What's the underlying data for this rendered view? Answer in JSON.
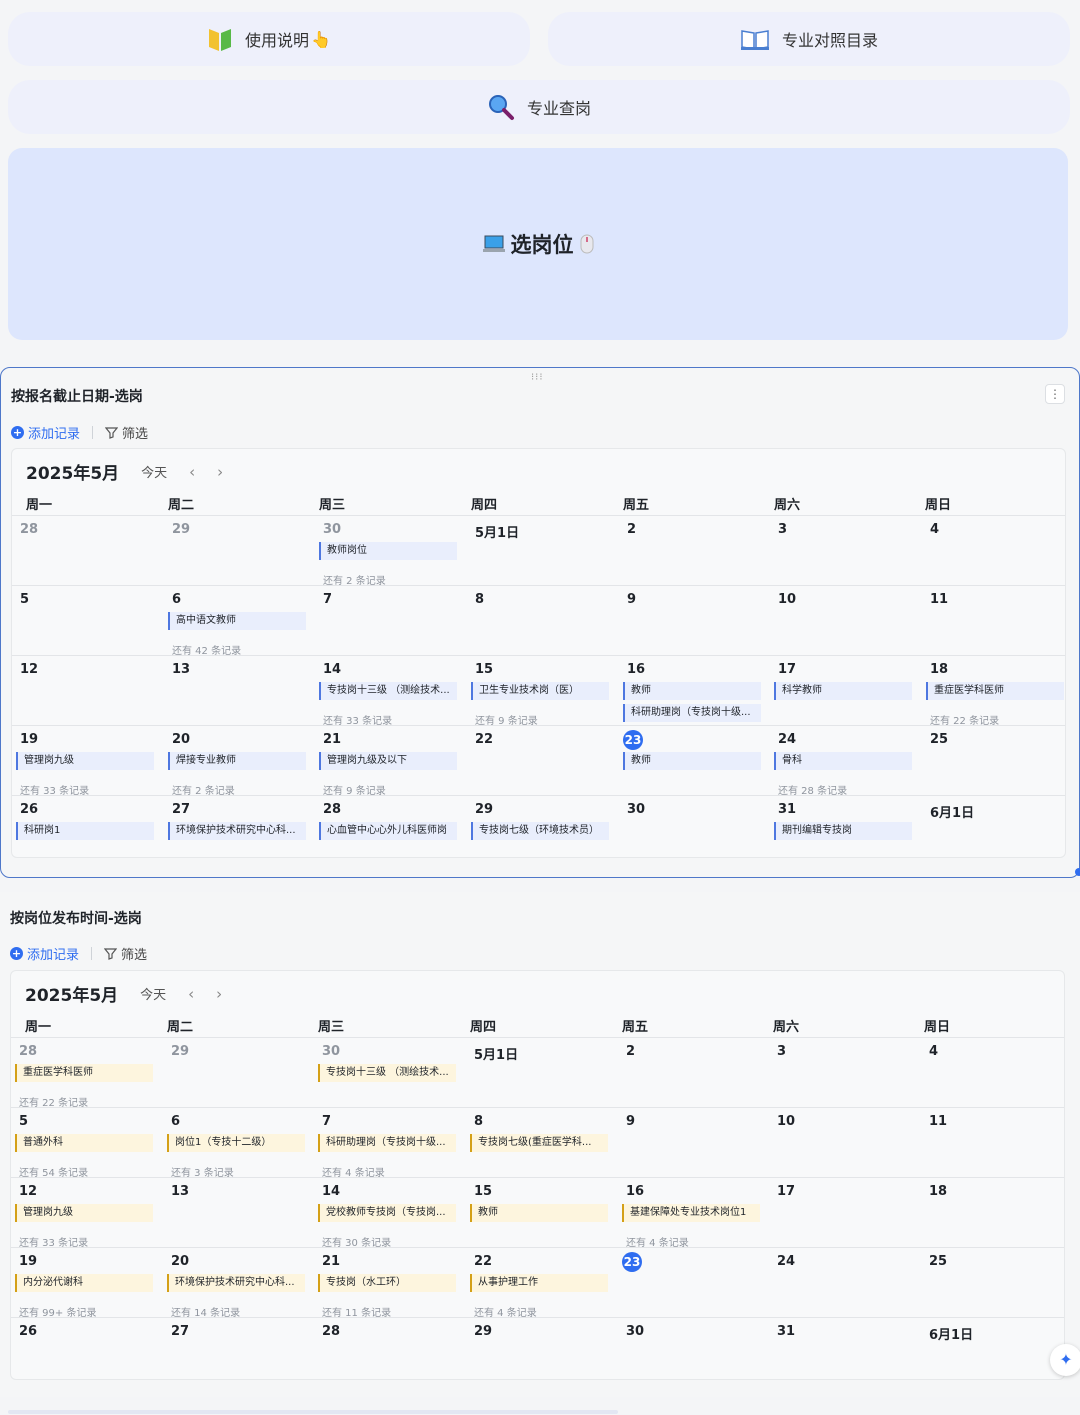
{
  "top_buttons": {
    "usage": {
      "label": "使用说明",
      "icon": "book-green-icon",
      "suffix": "👆"
    },
    "catalog": {
      "label": "专业对照目录",
      "icon": "open-book-icon"
    },
    "search": {
      "label": "专业查岗",
      "icon": "magnifier-icon"
    }
  },
  "hero": {
    "label": "选岗位",
    "icon": "laptop-icon",
    "suffix_icon": "mouse-icon"
  },
  "toolbar": {
    "add_label": "添加记录",
    "filter_label": "筛选"
  },
  "weekdays": [
    "周一",
    "周二",
    "周三",
    "周四",
    "周五",
    "周六",
    "周日"
  ],
  "calendars": [
    {
      "title": "按报名截止日期-选岗",
      "month": "2025年5月",
      "today_label": "今天",
      "weeks": [
        [
          {
            "d": "28",
            "dim": true
          },
          {
            "d": "29",
            "dim": true
          },
          {
            "d": "30",
            "dim": true,
            "ev": [
              "教师岗位"
            ],
            "more": "还有 2 条记录"
          },
          {
            "d": "5月1日"
          },
          {
            "d": "2"
          },
          {
            "d": "3"
          },
          {
            "d": "4"
          }
        ],
        [
          {
            "d": "5"
          },
          {
            "d": "6",
            "ev": [
              "高中语文教师"
            ],
            "more": "还有 42 条记录"
          },
          {
            "d": "7"
          },
          {
            "d": "8"
          },
          {
            "d": "9"
          },
          {
            "d": "10"
          },
          {
            "d": "11"
          }
        ],
        [
          {
            "d": "12"
          },
          {
            "d": "13"
          },
          {
            "d": "14",
            "ev": [
              "专技岗十三级 （测绘技术..."
            ],
            "more": "还有 33 条记录"
          },
          {
            "d": "15",
            "ev": [
              "卫生专业技术岗（医）"
            ],
            "more": "还有 9 条记录"
          },
          {
            "d": "16",
            "ev": [
              "教师",
              "科研助理岗（专技岗十级..."
            ]
          },
          {
            "d": "17",
            "ev": [
              "科学教师"
            ]
          },
          {
            "d": "18",
            "ev": [
              "重症医学科医师"
            ],
            "more": "还有 22 条记录"
          }
        ],
        [
          {
            "d": "19",
            "ev": [
              "管理岗九级"
            ],
            "more": "还有 33 条记录"
          },
          {
            "d": "20",
            "ev": [
              "焊接专业教师"
            ],
            "more": "还有 2 条记录"
          },
          {
            "d": "21",
            "ev": [
              "管理岗九级及以下"
            ],
            "more": "还有 9 条记录"
          },
          {
            "d": "22"
          },
          {
            "d": "23",
            "today": true,
            "ev": [
              "教师"
            ]
          },
          {
            "d": "24",
            "ev": [
              "骨科"
            ],
            "more": "还有 28 条记录"
          },
          {
            "d": "25"
          }
        ],
        [
          {
            "d": "26",
            "ev": [
              "科研岗1"
            ]
          },
          {
            "d": "27",
            "ev": [
              "环境保护技术研究中心科..."
            ]
          },
          {
            "d": "28",
            "ev": [
              "心血管中心心外儿科医师岗"
            ]
          },
          {
            "d": "29",
            "ev": [
              "专技岗七级（环境技术员）"
            ]
          },
          {
            "d": "30"
          },
          {
            "d": "31",
            "ev": [
              "期刊编辑专技岗"
            ]
          },
          {
            "d": "6月1日"
          }
        ]
      ]
    },
    {
      "title": "按岗位发布时间-选岗",
      "month": "2025年5月",
      "today_label": "今天",
      "weeks": [
        [
          {
            "d": "28",
            "dim": true,
            "ev": [
              "重症医学科医师"
            ],
            "more": "还有 22 条记录"
          },
          {
            "d": "29",
            "dim": true
          },
          {
            "d": "30",
            "dim": true,
            "ev": [
              "专技岗十三级 （测绘技术..."
            ]
          },
          {
            "d": "5月1日"
          },
          {
            "d": "2"
          },
          {
            "d": "3"
          },
          {
            "d": "4"
          }
        ],
        [
          {
            "d": "5",
            "ev": [
              "普通外科"
            ],
            "more": "还有 54 条记录"
          },
          {
            "d": "6",
            "ev": [
              "岗位1（专技十二级）"
            ],
            "more": "还有 3 条记录"
          },
          {
            "d": "7",
            "ev": [
              "科研助理岗（专技岗十级..."
            ],
            "more": "还有 4 条记录"
          },
          {
            "d": "8",
            "ev": [
              "专技岗七级(重症医学科..."
            ]
          },
          {
            "d": "9"
          },
          {
            "d": "10"
          },
          {
            "d": "11"
          }
        ],
        [
          {
            "d": "12",
            "ev": [
              "管理岗九级"
            ],
            "more": "还有 33 条记录"
          },
          {
            "d": "13"
          },
          {
            "d": "14",
            "ev": [
              "党校教师专技岗（专技岗..."
            ],
            "more": "还有 30 条记录"
          },
          {
            "d": "15",
            "ev": [
              "教师"
            ]
          },
          {
            "d": "16",
            "ev": [
              "基建保障处专业技术岗位1"
            ],
            "more": "还有 4 条记录"
          },
          {
            "d": "17"
          },
          {
            "d": "18"
          }
        ],
        [
          {
            "d": "19",
            "ev": [
              "内分泌代谢科"
            ],
            "more": "还有 99+ 条记录"
          },
          {
            "d": "20",
            "ev": [
              "环境保护技术研究中心科..."
            ],
            "more": "还有 14 条记录"
          },
          {
            "d": "21",
            "ev": [
              "专技岗（水工环）"
            ],
            "more": "还有 11 条记录"
          },
          {
            "d": "22",
            "ev": [
              "从事护理工作"
            ],
            "more": "还有 4 条记录"
          },
          {
            "d": "23",
            "today": true
          },
          {
            "d": "24"
          },
          {
            "d": "25"
          }
        ],
        [
          {
            "d": "26"
          },
          {
            "d": "27"
          },
          {
            "d": "28"
          },
          {
            "d": "29"
          },
          {
            "d": "30"
          },
          {
            "d": "31"
          },
          {
            "d": "6月1日"
          }
        ]
      ]
    }
  ],
  "colors": {
    "accent": "#2f6df0",
    "event_blue": "#4e77e0",
    "event_gold": "#d4a017",
    "hero_bg": "#dde6fd"
  }
}
